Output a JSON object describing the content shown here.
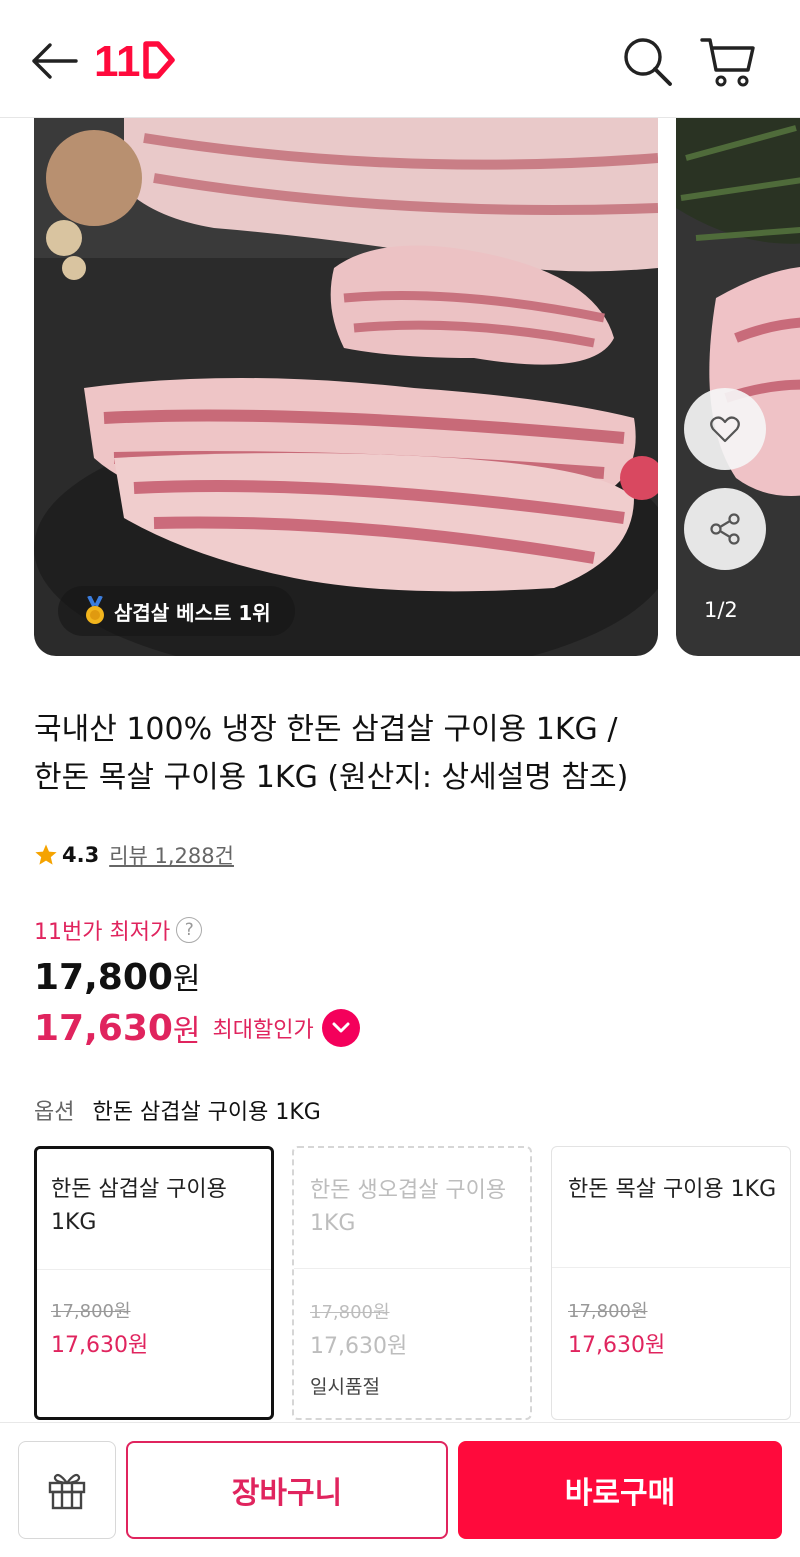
{
  "header": {
    "back_icon": "back-arrow-icon",
    "logo_text": "11",
    "search_icon": "search-icon",
    "cart_icon": "cart-icon"
  },
  "gallery": {
    "badge": "삼겹살 베스트 1위",
    "badge_icon": "medal-icon",
    "pager": "1/2",
    "like_icon": "heart-icon",
    "share_icon": "share-icon"
  },
  "product": {
    "title_line1": "국내산 100% 냉장 한돈 삼겹살 구이용 1KG /",
    "title_line2": "한돈 목살 구이용 1KG (원산지: 상세설명 참조)",
    "rating": "4.3",
    "review": "리뷰 1,288건",
    "lowest_label": "11번가 최저가",
    "help": "?",
    "price_number": "17,800",
    "price_unit": "원",
    "sale_number": "17,630",
    "sale_unit": "원",
    "sale_label": "최대할인가"
  },
  "options": {
    "label": "옵션",
    "selected": "한돈 삼겹살 구이용 1KG",
    "cards": [
      {
        "name": "한돈 삼겹살 구이용 1KG",
        "orig": "17,800원",
        "price": "17,630원",
        "status": ""
      },
      {
        "name": "한돈 생오겹살 구이용 1KG",
        "orig": "17,800원",
        "price": "17,630원",
        "status": "일시품절"
      },
      {
        "name": "한돈 목살 구이용 1KG",
        "orig": "17,800원",
        "price": "17,630원",
        "status": ""
      }
    ]
  },
  "bottom": {
    "gift_icon": "gift-icon",
    "cart_label": "장바구니",
    "buy_label": "바로구매"
  },
  "colors": {
    "brand": "#ff0a3c",
    "price_pink": "#e0245e"
  }
}
